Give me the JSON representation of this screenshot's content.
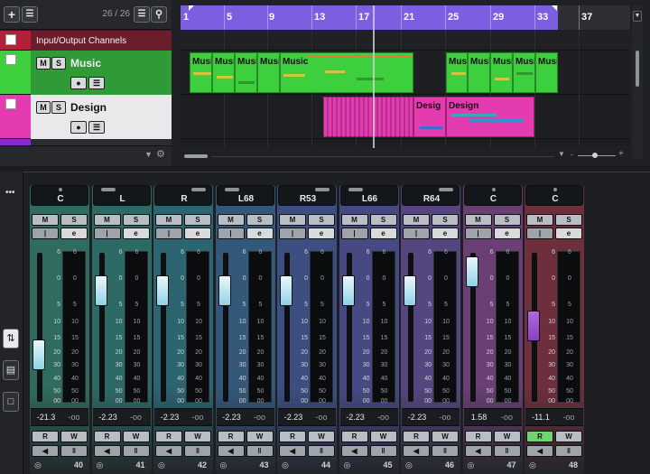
{
  "toolbar": {
    "add_icon": "plus-icon",
    "add_folder_icon": "add-track-menu-icon",
    "track_count": "26 / 26",
    "list_icon": "list-icon",
    "search_icon": "search-icon"
  },
  "tracks": [
    {
      "name": "Input/Output Channels",
      "color": "#b3203a"
    },
    {
      "name": "Music",
      "color": "#3ecf3e",
      "mute": "M",
      "solo": "S"
    },
    {
      "name": "Design",
      "color": "#e43bb1",
      "mute": "M",
      "solo": "S"
    }
  ],
  "ruler": {
    "markers": [
      "1",
      "5",
      "9",
      "13",
      "17",
      "21",
      "25",
      "29",
      "33",
      "37"
    ]
  },
  "clips": {
    "music": [
      "Musi",
      "Musi",
      "Musi",
      "Musi",
      "Music",
      "Musi",
      "Musi",
      "Musi",
      "Musi",
      "Musi"
    ],
    "design": [
      "Desig",
      "Design"
    ]
  },
  "mixer": {
    "channels": [
      {
        "pan": "C",
        "mute": "M",
        "solo": "S",
        "vol": "-21.3",
        "peak": "-oo",
        "read": "R",
        "write": "W",
        "num": "40",
        "tint": "#2f6b5e",
        "fader_db": -21.3
      },
      {
        "pan": "L",
        "mute": "M",
        "solo": "S",
        "vol": "-2.23",
        "peak": "-oo",
        "read": "R",
        "write": "W",
        "num": "41",
        "tint": "#2d6a66",
        "fader_db": -2.23
      },
      {
        "pan": "R",
        "mute": "M",
        "solo": "S",
        "vol": "-2.23",
        "peak": "-oo",
        "read": "R",
        "write": "W",
        "num": "42",
        "tint": "#2c6470",
        "fader_db": -2.23
      },
      {
        "pan": "L68",
        "mute": "M",
        "solo": "S",
        "vol": "-2.23",
        "peak": "-oo",
        "read": "R",
        "write": "W",
        "num": "43",
        "tint": "#34587a",
        "fader_db": -2.23
      },
      {
        "pan": "R53",
        "mute": "M",
        "solo": "S",
        "vol": "-2.23",
        "peak": "-oo",
        "read": "R",
        "write": "W",
        "num": "44",
        "tint": "#3c4f80",
        "fader_db": -2.23
      },
      {
        "pan": "L66",
        "mute": "M",
        "solo": "S",
        "vol": "-2.23",
        "peak": "-oo",
        "read": "R",
        "write": "W",
        "num": "45",
        "tint": "#474a82",
        "fader_db": -2.23
      },
      {
        "pan": "R64",
        "mute": "M",
        "solo": "S",
        "vol": "-2.23",
        "peak": "-oo",
        "read": "R",
        "write": "W",
        "num": "46",
        "tint": "#554680",
        "fader_db": -2.23
      },
      {
        "pan": "C",
        "mute": "M",
        "solo": "S",
        "vol": "1.58",
        "peak": "-oo",
        "read": "R",
        "write": "W",
        "num": "47",
        "tint": "#6a3f74",
        "fader_db": 1.58
      },
      {
        "pan": "C",
        "mute": "M",
        "solo": "S",
        "vol": "-11.1",
        "peak": "-oo",
        "read": "R",
        "write": "W",
        "num": "48",
        "tint": "#6e2f3c",
        "fader_db": -11.1,
        "read_active": true
      }
    ],
    "scale": [
      "6",
      "0",
      "5",
      "10",
      "15",
      "20",
      "30",
      "40",
      "50",
      "00"
    ],
    "meter_scale": [
      "6",
      "0",
      "5",
      "10",
      "15",
      "20",
      "30",
      "40",
      "50",
      "00"
    ]
  },
  "colors": {
    "accent": "#7b5fe0",
    "music": "#3ecf3e",
    "design": "#e43bb1",
    "io": "#b3203a"
  }
}
